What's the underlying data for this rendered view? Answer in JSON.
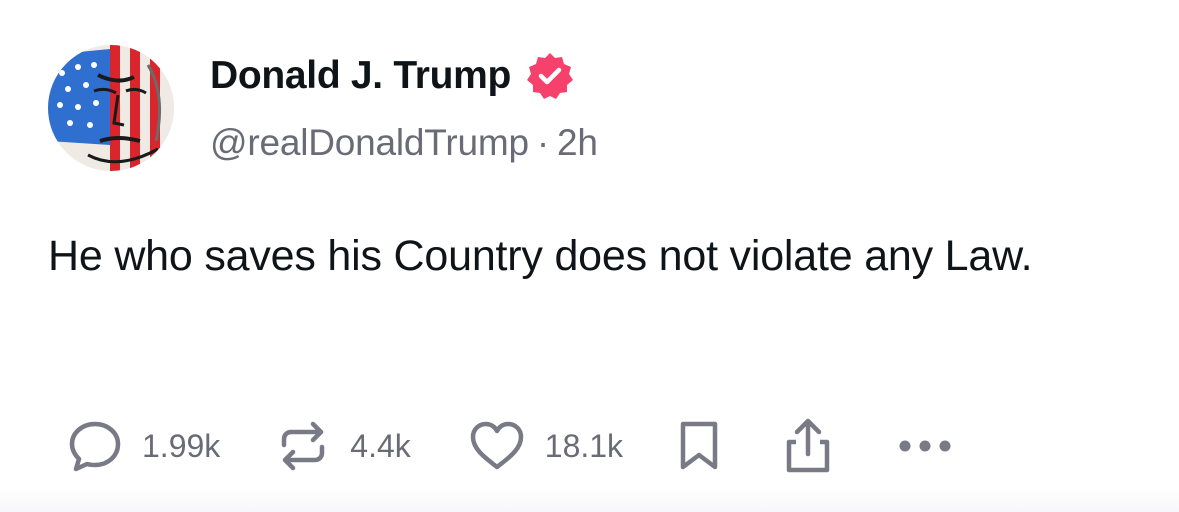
{
  "post": {
    "display_name": "Donald J. Trump",
    "handle": "@realDonaldTrump",
    "separator": "·",
    "time": "2h",
    "text": "He who saves his Country does not violate any Law.",
    "verified_badge_color": "#f5416c",
    "avatar_icon": "avatar-flag-portrait",
    "verified_icon": "verified-badge-icon"
  },
  "actions": {
    "replies": {
      "count": "1.99k",
      "icon": "reply-icon"
    },
    "reposts": {
      "count": "4.4k",
      "icon": "repost-icon"
    },
    "likes": {
      "count": "18.1k",
      "icon": "heart-icon"
    },
    "bookmark": {
      "icon": "bookmark-icon"
    },
    "share": {
      "icon": "share-icon"
    },
    "more": {
      "icon": "more-icon"
    }
  },
  "colors": {
    "text": "#0f1419",
    "secondary": "#6b6b77",
    "icon": "#7a7a86"
  }
}
